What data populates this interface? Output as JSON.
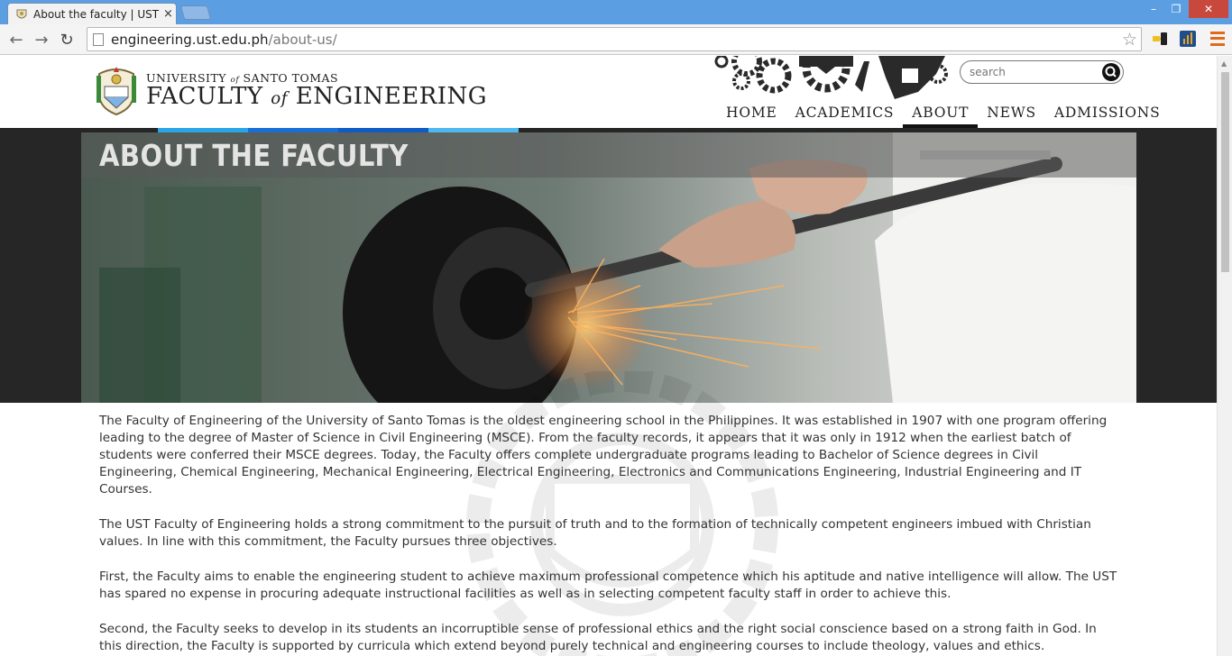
{
  "browser": {
    "tab_title": "About the faculty | UST - F",
    "tab_close": "×",
    "url_host": "engineering.ust.edu.ph",
    "url_path": "/about-us/",
    "window_minimize": "–",
    "window_maximize": "❐",
    "window_close": "✕",
    "back_icon": "←",
    "forward_icon": "→",
    "reload_icon": "↻",
    "star_icon": "☆"
  },
  "site": {
    "logo_line1_pre": "UNIVERSITY ",
    "logo_line1_of": "of",
    "logo_line1_post": " SANTO TOMAS",
    "logo_line2_pre": "FACULTY ",
    "logo_line2_of": "of",
    "logo_line2_post": " ENGINEERING",
    "search_placeholder": "search",
    "nav": [
      {
        "label": "HOME"
      },
      {
        "label": "ACADEMICS"
      },
      {
        "label": "ABOUT"
      },
      {
        "label": "NEWS"
      },
      {
        "label": "ADMISSIONS"
      }
    ],
    "active_nav": "ABOUT",
    "accent_colors": [
      "#2aa6e8",
      "#1a6fd6",
      "#0e5cc4",
      "#4fb8ee"
    ]
  },
  "hero": {
    "title": "ABOUT THE FACULTY"
  },
  "content": {
    "paragraphs": [
      "The Faculty of Engineering of the University of Santo Tomas is the oldest engineering school in the Philippines. It was established in 1907 with one program offering leading to the degree of Master of Science in Civil Engineering (MSCE). From the faculty records, it appears that it was only in 1912 when the earliest batch of students were conferred their MSCE degrees. Today, the Faculty offers complete undergraduate programs leading to Bachelor of Science degrees in Civil Engineering, Chemical Engineering, Mechanical Engineering, Electrical Engineering, Electronics and Communications Engineering, Industrial Engineering and IT Courses.",
      "The UST Faculty of Engineering holds a strong commitment to the pursuit of truth and to the formation of technically competent engineers imbued with Christian values. In line with this commitment, the Faculty pursues three objectives.",
      "First, the Faculty aims to enable the engineering student to achieve maximum professional competence which his aptitude and native intelligence will allow. The UST has spared no expense in procuring adequate instructional facilities as well as in selecting competent faculty staff in order to achieve this.",
      "Second, the Faculty seeks to develop in its students an incorruptible sense of professional ethics and the right social conscience based on a strong faith in God. In this direction, the Faculty is supported by curricula which extend beyond purely technical and engineering courses to include theology, values and ethics."
    ]
  }
}
